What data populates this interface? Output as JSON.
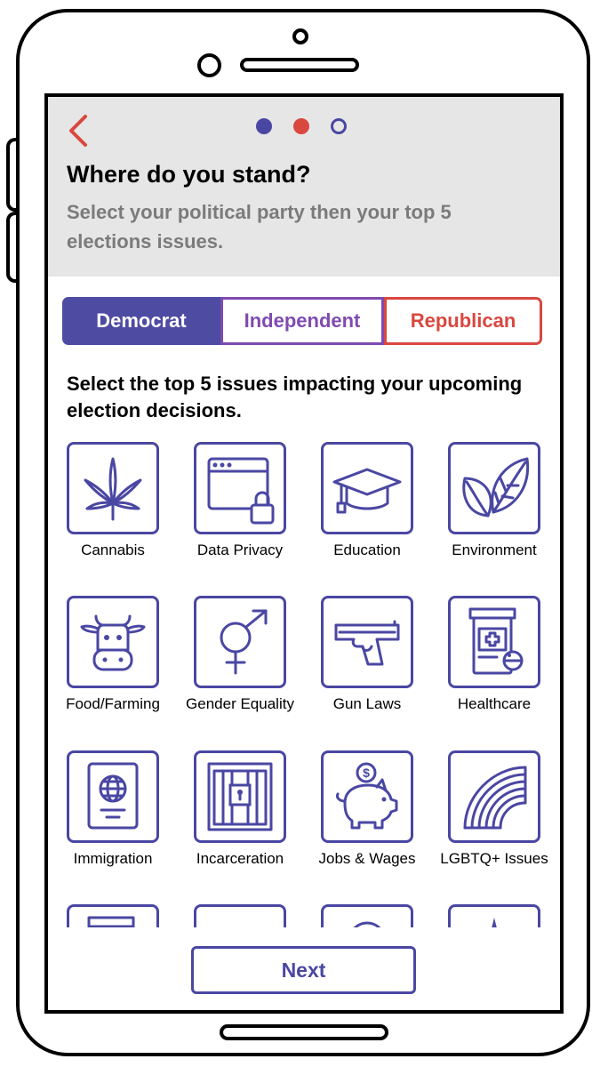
{
  "header": {
    "title": "Where do you stand?",
    "subtitle": "Select your political party then your top 5 elections issues.",
    "back_icon": "chevron-left-icon",
    "progress": {
      "total_steps": 3,
      "current_step": 2
    }
  },
  "party_selector": {
    "options": [
      "Democrat",
      "Independent",
      "Republican"
    ],
    "selected": "Democrat"
  },
  "issues_section": {
    "title": "Select the top 5 issues impacting your upcoming election decisions.",
    "items": [
      {
        "label": "Cannabis",
        "icon": "cannabis-leaf-icon"
      },
      {
        "label": "Data Privacy",
        "icon": "browser-lock-icon"
      },
      {
        "label": "Education",
        "icon": "graduation-cap-icon"
      },
      {
        "label": "Environment",
        "icon": "leaves-icon"
      },
      {
        "label": "Food/Farming",
        "icon": "cow-icon"
      },
      {
        "label": "Gender Equality",
        "icon": "gender-symbol-icon"
      },
      {
        "label": "Gun Laws",
        "icon": "pistol-icon"
      },
      {
        "label": "Healthcare",
        "icon": "medicine-bottle-icon"
      },
      {
        "label": "Immigration",
        "icon": "passport-icon"
      },
      {
        "label": "Incarceration",
        "icon": "jail-cell-icon"
      },
      {
        "label": "Jobs & Wages",
        "icon": "piggy-bank-icon"
      },
      {
        "label": "LGBTQ+ Issues",
        "icon": "rainbow-icon"
      }
    ]
  },
  "next_button": {
    "label": "Next"
  },
  "colors": {
    "primary": "#4a47a3",
    "democrat": "#4e4ba3",
    "independent": "#7f4ab0",
    "republican": "#d9473f",
    "header_bg": "#e6e6e6",
    "subtitle": "#7b7b7b"
  }
}
